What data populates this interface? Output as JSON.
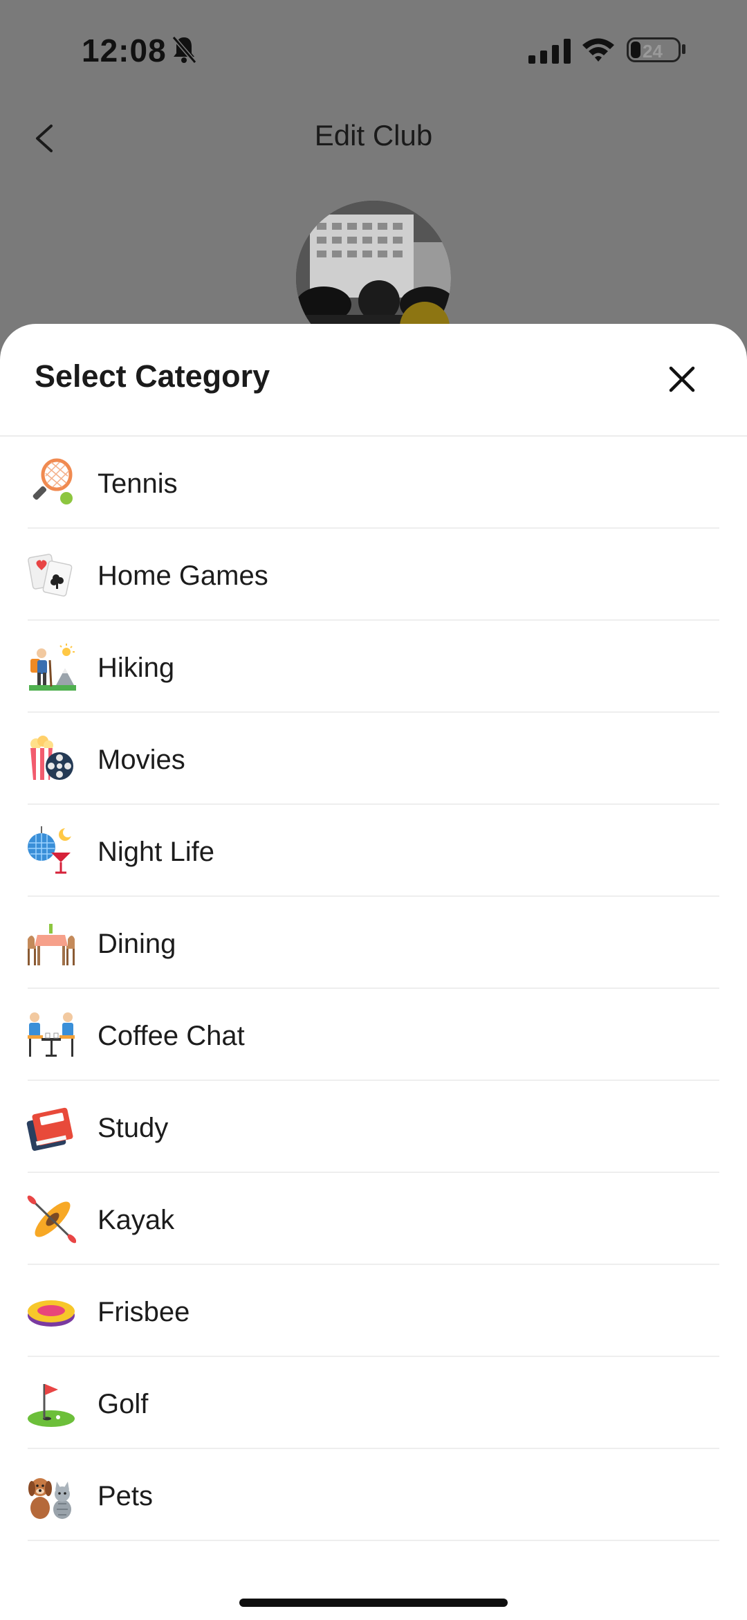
{
  "status_bar": {
    "time": "12:08",
    "battery": "24"
  },
  "header": {
    "title": "Edit Club"
  },
  "sheet": {
    "title": "Select Category",
    "categories": [
      {
        "label": "Tennis",
        "icon": "tennis-racket-icon"
      },
      {
        "label": "Home Games",
        "icon": "playing-cards-icon"
      },
      {
        "label": "Hiking",
        "icon": "hiker-icon"
      },
      {
        "label": "Movies",
        "icon": "popcorn-film-reel-icon"
      },
      {
        "label": "Night Life",
        "icon": "disco-ball-cocktail-icon"
      },
      {
        "label": "Dining",
        "icon": "dining-table-icon"
      },
      {
        "label": "Coffee Chat",
        "icon": "coffee-chat-icon"
      },
      {
        "label": "Study",
        "icon": "book-icon"
      },
      {
        "label": "Kayak",
        "icon": "kayak-icon"
      },
      {
        "label": "Frisbee",
        "icon": "frisbee-icon"
      },
      {
        "label": "Golf",
        "icon": "golf-flag-icon"
      },
      {
        "label": "Pets",
        "icon": "dog-cat-icon"
      }
    ]
  }
}
